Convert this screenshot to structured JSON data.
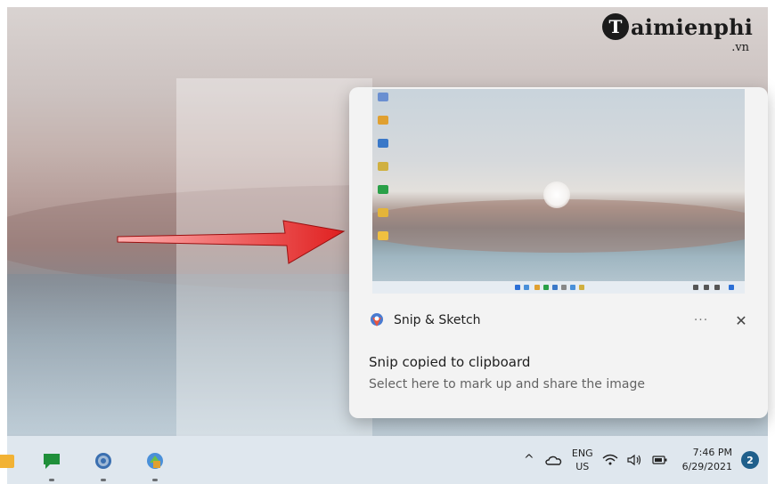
{
  "watermark": {
    "logo_letter": "T",
    "text": "aimienphi",
    "suffix": ".vn"
  },
  "notification": {
    "app_name": "Snip & Sketch",
    "more_label": "···",
    "close_label": "✕",
    "title": "Snip copied to clipboard",
    "body": "Select here to mark up and share the image"
  },
  "taskbar": {
    "chevron": "^",
    "language": {
      "line1": "ENG",
      "line2": "US"
    },
    "clock": {
      "time": "7:46 PM",
      "date": "6/29/2021"
    },
    "notification_count": "2",
    "icons": [
      "file-explorer-icon",
      "chat-icon",
      "settings-icon",
      "control-panel-icon",
      "onedrive-icon",
      "wifi-icon",
      "volume-icon",
      "battery-icon"
    ]
  },
  "colors": {
    "arrow": "#e02020",
    "badge": "#1f5f8b",
    "toast_bg": "#f3f3f3"
  }
}
